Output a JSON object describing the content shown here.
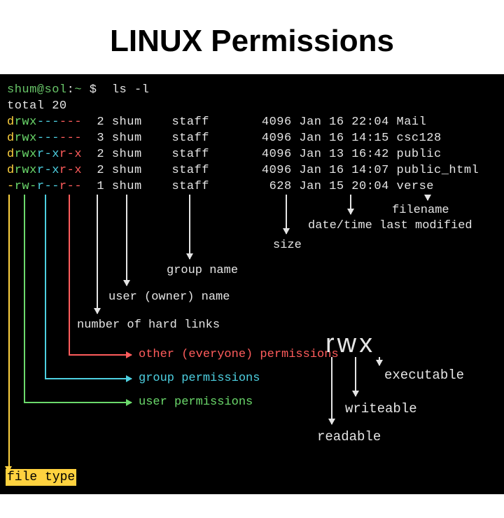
{
  "title": "LINUX Permissions",
  "prompt": {
    "user": "shum@sol",
    "path": "~",
    "symbol": "$",
    "command": "ls -l"
  },
  "total_line": "total 20",
  "listing": [
    {
      "type": "d",
      "user_perm": "rwx",
      "group_perm": "---",
      "other_perm": "---",
      "links": "2",
      "owner": "shum",
      "group": "staff",
      "size": "4096",
      "date": "Jan 16 22:04",
      "name": "Mail"
    },
    {
      "type": "d",
      "user_perm": "rwx",
      "group_perm": "---",
      "other_perm": "---",
      "links": "3",
      "owner": "shum",
      "group": "staff",
      "size": "4096",
      "date": "Jan 16 14:15",
      "name": "csc128"
    },
    {
      "type": "d",
      "user_perm": "rwx",
      "group_perm": "r-x",
      "other_perm": "r-x",
      "links": "2",
      "owner": "shum",
      "group": "staff",
      "size": "4096",
      "date": "Jan 13 16:42",
      "name": "public"
    },
    {
      "type": "d",
      "user_perm": "rwx",
      "group_perm": "r-x",
      "other_perm": "r-x",
      "links": "2",
      "owner": "shum",
      "group": "staff",
      "size": "4096",
      "date": "Jan 16 14:07",
      "name": "public_html"
    },
    {
      "type": "-",
      "user_perm": "rw-",
      "group_perm": "r--",
      "other_perm": "r--",
      "links": "1",
      "owner": "shum",
      "group": "staff",
      "size": "628",
      "date": "Jan 15 20:04",
      "name": "verse"
    }
  ],
  "annotations": {
    "filename": "filename",
    "datetime": "date/time last modified",
    "size": "size",
    "group_name": "group name",
    "owner_name": "user (owner) name",
    "hard_links": "number of hard links",
    "other_perm": "other (everyone) permissions",
    "group_perm": "group permissions",
    "user_perm": "user permissions",
    "file_type": "file type"
  },
  "rwx": {
    "title": "rwx",
    "executable": "executable",
    "writeable": "writeable",
    "readable": "readable"
  }
}
